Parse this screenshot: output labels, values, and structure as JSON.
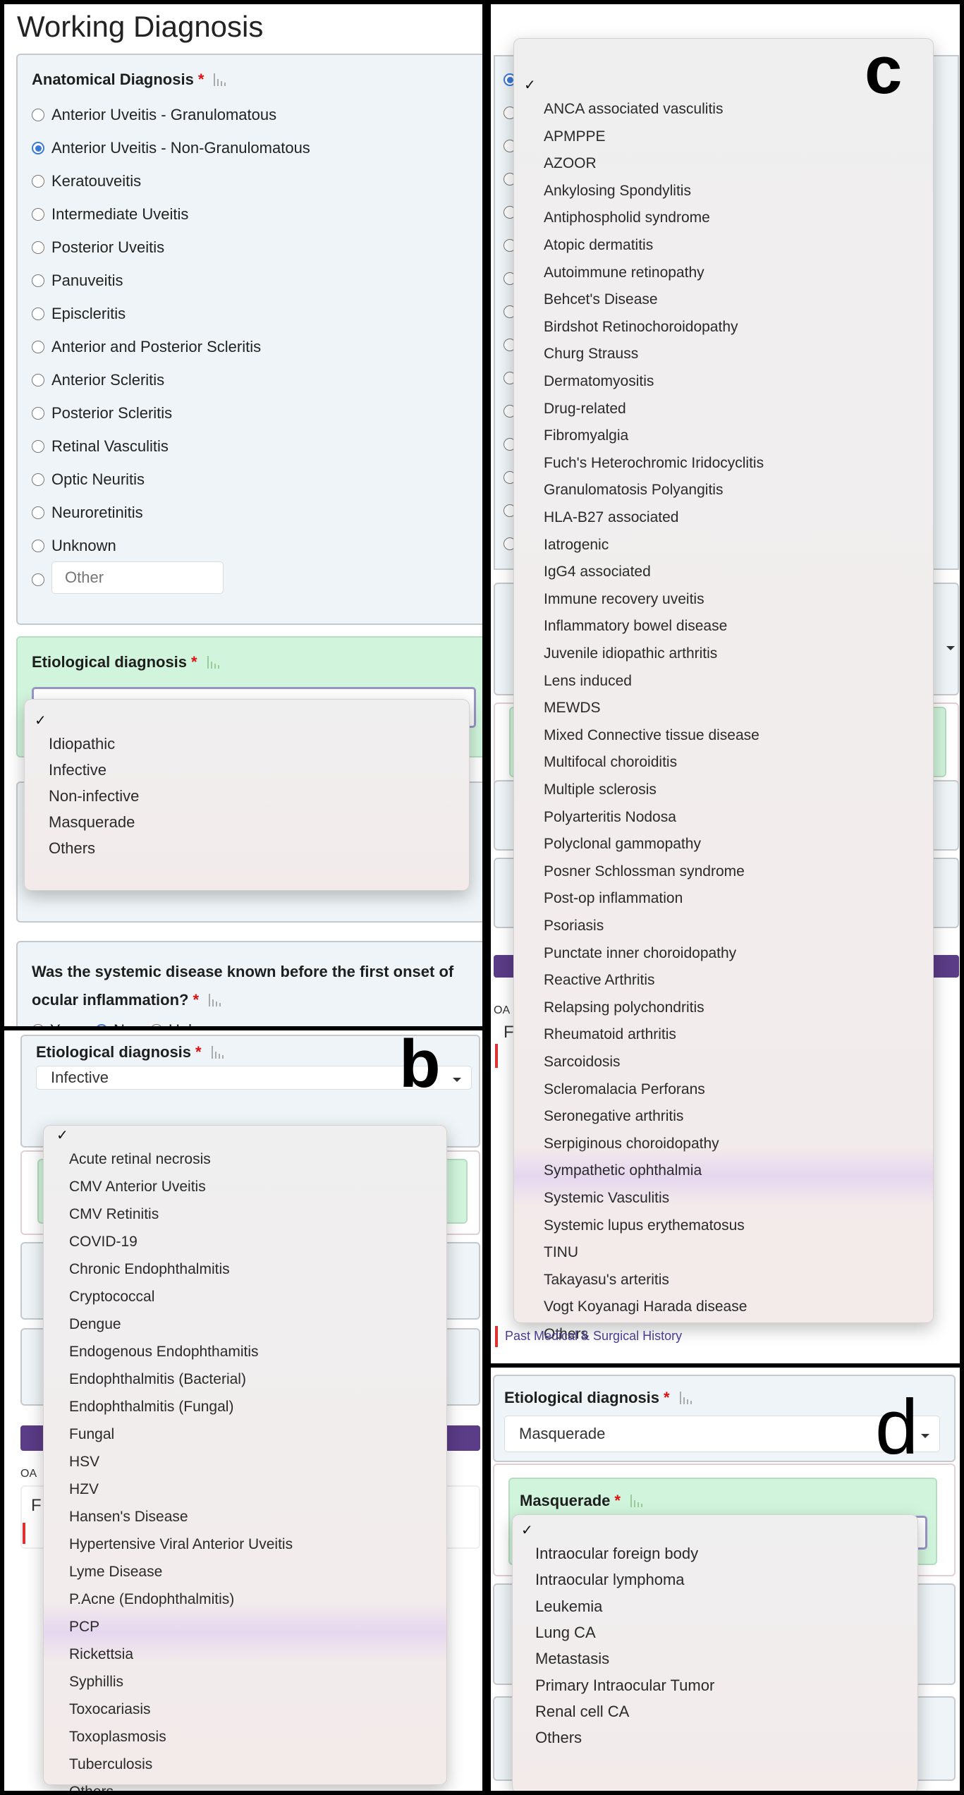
{
  "panel_a": {
    "letter": "a",
    "title": "Working Diagnosis",
    "anatomical": {
      "label": "Anatomical Diagnosis",
      "required": "*",
      "options": [
        "Anterior Uveitis - Granulomatous",
        "Anterior Uveitis - Non-Granulomatous",
        "Keratouveitis",
        "Intermediate Uveitis",
        "Posterior Uveitis",
        "Panuveitis",
        "Episcleritis",
        "Anterior and Posterior Scleritis",
        "Anterior Scleritis",
        "Posterior Scleritis",
        "Retinal Vasculitis",
        "Optic Neuritis",
        "Neuroretinitis",
        "Unknown"
      ],
      "selected": "Anterior Uveitis - Non-Granulomatous",
      "other_placeholder": "Other"
    },
    "etiological": {
      "label": "Etiological diagnosis",
      "required": "*",
      "check": "✓",
      "options": [
        "Idiopathic",
        "Infective",
        "Non-infective",
        "Masquerade",
        "Others"
      ]
    },
    "systemic_question": {
      "label": "Was the systemic disease known before the first onset of ocular inflammation?",
      "required": "*",
      "options": [
        "Yes",
        "No",
        "Unknown"
      ],
      "selected": "No"
    }
  },
  "panel_b": {
    "letter": "b",
    "label": "Etiological diagnosis",
    "required": "*",
    "value": "Infective",
    "check": "✓",
    "highlighted": "PCP",
    "options": [
      "Acute retinal necrosis",
      "CMV Anterior Uveitis",
      "CMV Retinitis",
      "COVID-19",
      "Chronic Endophthalmitis",
      "Cryptococcal",
      "Dengue",
      "Endogenous Endophthamitis",
      "Endophthalmitis (Bacterial)",
      "Endophthalmitis (Fungal)",
      "Fungal",
      "HSV",
      "HZV",
      "Hansen's Disease",
      "Hypertensive Viral Anterior Uveitis",
      "Lyme Disease",
      "P.Acne (Endophthalmitis)",
      "PCP",
      "Rickettsia",
      "Syphillis",
      "Toxocariasis",
      "Toxoplasmosis",
      "Tuberculosis",
      "Others"
    ],
    "fragments": {
      "oa": "OA",
      "f": "F"
    }
  },
  "panel_c": {
    "letter": "c",
    "check": "✓",
    "highlighted": "Sympathetic ophthalmia",
    "options": [
      "ANCA associated vasculitis",
      "APMPPE",
      "AZOOR",
      "Ankylosing Spondylitis",
      "Antiphospholid syndrome",
      "Atopic dermatitis",
      "Autoimmune retinopathy",
      "Behcet's Disease",
      "Birdshot Retinochoroidopathy",
      "Churg Strauss",
      "Dermatomyositis",
      "Drug-related",
      "Fibromyalgia",
      "Fuch's Heterochromic Iridocyclitis",
      "Granulomatosis Polyangitis",
      "HLA-B27 associated",
      "Iatrogenic",
      "IgG4 associated",
      "Immune recovery uveitis",
      "Inflammatory bowel disease",
      "Juvenile idiopathic arthritis",
      "Lens induced",
      "MEWDS",
      "Mixed Connective tissue disease",
      "Multifocal choroiditis",
      "Multiple sclerosis",
      "Polyarteritis Nodosa",
      "Polyclonal gammopathy",
      "Posner Schlossman syndrome",
      "Post-op inflammation",
      "Psoriasis",
      "Punctate inner choroidopathy",
      "Reactive Arthritis",
      "Relapsing polychondritis",
      "Rheumatoid arthritis",
      "Sarcoidosis",
      "Scleromalacia Perforans",
      "Seronegative arthritis",
      "Serpiginous choroidopathy",
      "Sympathetic ophthalmia",
      "Systemic Vasculitis",
      "Systemic lupus erythematosus",
      "TINU",
      "Takayasu's arteritis",
      "Vogt Koyanagi Harada disease",
      "Others"
    ],
    "fragments": {
      "oa": "OA",
      "f": "F",
      "link": "Past Medical & Surgical History"
    }
  },
  "panel_d": {
    "letter": "d",
    "label": "Etiological diagnosis",
    "required": "*",
    "value": "Masquerade",
    "sub_label": "Masquerade",
    "sub_required": "*",
    "check": "✓",
    "options": [
      "Intraocular foreign body",
      "Intraocular lymphoma",
      "Leukemia",
      "Lung CA",
      "Metastasis",
      "Primary Intraocular Tumor",
      "Renal cell CA",
      "Others"
    ]
  },
  "colors": {
    "panel_bg": "#eef4f7",
    "active_panel_bg": "#d1f5dc",
    "radio_selected": "#3b78d8",
    "required": "#e01010",
    "primary_bar": "#5b3c87",
    "dropdown_bg": "#f2ecec",
    "hover_highlight": "#e6d7ef"
  }
}
